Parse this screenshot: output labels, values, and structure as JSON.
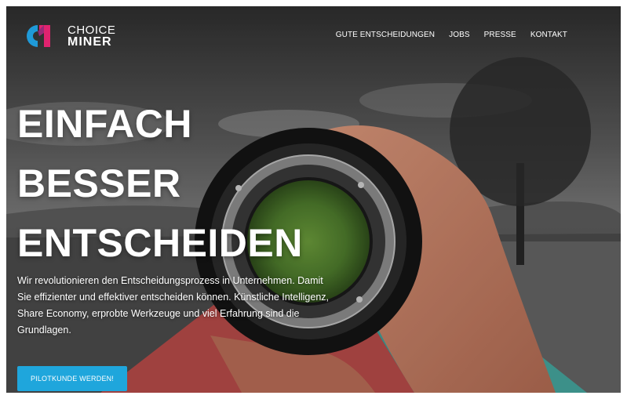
{
  "logo": {
    "line1": "CHOICE",
    "line2": "MINER",
    "colors": {
      "blue": "#1f9ad8",
      "magenta": "#e0236f"
    }
  },
  "nav": {
    "items": [
      {
        "label": "GUTE ENTSCHEIDUNGEN"
      },
      {
        "label": "JOBS"
      },
      {
        "label": "PRESSE"
      },
      {
        "label": "KONTAKT"
      }
    ]
  },
  "hero": {
    "headline": [
      "EINFACH",
      "BESSER",
      "ENTSCHEIDEN"
    ],
    "intro": "Wir revolutionieren den Entscheidungsprozess in Unternehmen. Damit Sie effizienter und effektiver entscheiden können. Künstliche Intelligenz, Share Economy, erprobte Werkzeuge und viel Erfahrung sind die Grundlagen.",
    "cta_label": "PILOTKUNDE WERDEN!"
  },
  "colors": {
    "accent": "#1fa6dc",
    "text": "#ffffff"
  }
}
